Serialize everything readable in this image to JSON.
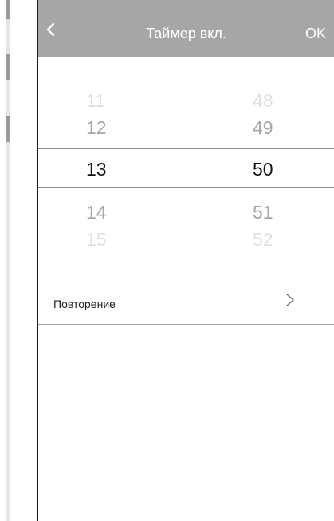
{
  "header": {
    "back_icon": "chevron-left-icon",
    "title": "Таймер вкл.",
    "ok_label": "OK"
  },
  "picker": {
    "hours": {
      "far_above": "11",
      "near_above": "12",
      "selected": "13",
      "near_below": "14",
      "far_below": "15"
    },
    "minutes": {
      "far_above": "48",
      "near_above": "49",
      "selected": "50",
      "near_below": "51",
      "far_below": "52"
    }
  },
  "repeat": {
    "label": "Повторение",
    "icon": "chevron-right-icon"
  },
  "colors": {
    "header_bg": "#a6a6a6",
    "header_text": "#ffffff",
    "selected_text": "#111111",
    "near_text": "#a5a5a5",
    "far_text": "#e0e0e0"
  }
}
